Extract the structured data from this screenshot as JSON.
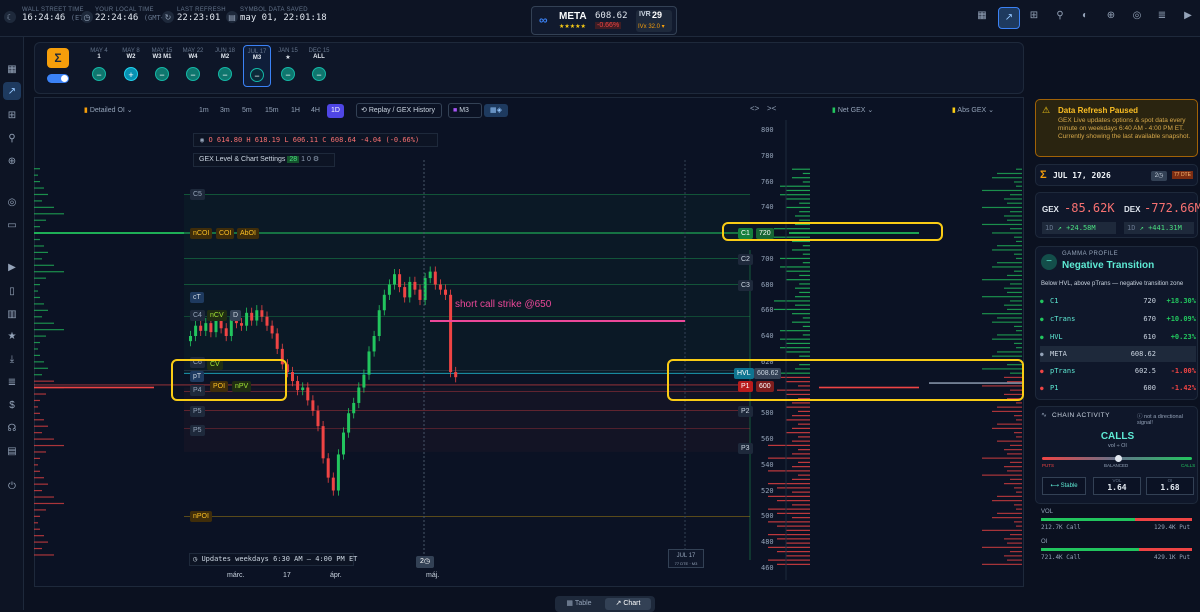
{
  "topbar": {
    "wst_label": "WALL STREET TIME",
    "wst_value": "16:24:46",
    "wst_tz": "(ET)",
    "local_label": "YOUR LOCAL TIME",
    "local_value": "22:24:46",
    "local_tz": "(GMT+2)",
    "refresh_label": "LAST REFRESH",
    "refresh_value": "22:23:01",
    "saved_label": "SYMBOL DATA SAVED",
    "saved_value": "may 01, 22:01:18"
  },
  "ticker": {
    "symbol": "META",
    "stars": "★★★★★",
    "price": "608.62",
    "change": "-0.66%",
    "ivr_label": "IVR",
    "ivr_value": "29",
    "iv_text": "IVx 32.0 ▾"
  },
  "expirations": [
    {
      "date": "MAY 4",
      "label": "1",
      "btn": "−"
    },
    {
      "date": "MAY 8",
      "label": "W2",
      "btn": "+"
    },
    {
      "date": "MAY 15",
      "label": "W3 M1",
      "btn": "−"
    },
    {
      "date": "MAY 22",
      "label": "W4",
      "btn": "−"
    },
    {
      "date": "JUN 18",
      "label": "M2",
      "btn": "−"
    },
    {
      "date": "JUL 17",
      "label": "M3",
      "btn": "−"
    },
    {
      "date": "JAN 15",
      "label": "★",
      "btn": "−"
    },
    {
      "date": "DEC 15",
      "label": "ALL",
      "btn": "−"
    }
  ],
  "toolbar": {
    "detailed_oi": "Detailed OI ⌄",
    "timeframes": [
      "1m",
      "3m",
      "5m",
      "15m",
      "1H",
      "4H",
      "1D"
    ],
    "replay": "Replay / GEX History",
    "m3": "M3",
    "net_gex": "Net GEX ⌄",
    "abs_gex": "Abs GEX ⌄"
  },
  "ohlc": {
    "o": "O 614.80",
    "h": "H 618.19",
    "l": "L 606.11",
    "c": "C 608.64",
    "chg": "-4.04 (-0.66%)"
  },
  "settings": {
    "label": "GEX Level & Chart Settings",
    "badge1": "28",
    "badge2": "1",
    "badge3": "0"
  },
  "price_axis": [
    "800",
    "780",
    "760",
    "740",
    "720",
    "700",
    "680",
    "660",
    "640",
    "620",
    "600",
    "580",
    "560",
    "540",
    "520",
    "500",
    "480",
    "460"
  ],
  "date_axis": [
    "márc.",
    "17",
    "ápr.",
    "máj."
  ],
  "levels": {
    "c1": "C1",
    "c1v": "720",
    "c2": "C2",
    "c3": "C3",
    "hvl": "HVL",
    "hvl_v": "608.62",
    "p1": "P1",
    "p1v": "600",
    "p2": "P2",
    "p3": "P3"
  },
  "left_tags": {
    "c5": "C5",
    "ncoi": "nCOI",
    "coi": "COI",
    "aboi": "AbOI",
    "ct": "cT",
    "c4": "C4",
    "ncv": "nCV",
    "d": "D",
    "cv": "CV",
    "pt": "pT",
    "poi": "POI",
    "npv": "nPV",
    "p5a": "P5",
    "p5b": "P5",
    "npoi": "nPOI",
    "c6": "C6",
    "p4": "P4"
  },
  "annotation": "short call strike @650",
  "footer_note": "Updates weekdays 6:30 AM – 4:00 PM ET",
  "footer_badge": "2",
  "expiry_marker": {
    "date": "JUL 17",
    "sub": "77 DTE · M3"
  },
  "alert": {
    "title": "Data Refresh Paused",
    "body": "GEX Live updates options & spot data every minute on weekdays 6:40 AM - 4:00 PM ET. Currently showing the last available snapshot."
  },
  "summary": {
    "date": "JUL 17, 2026",
    "dte": "77 DTE",
    "gex_label": "GEX",
    "gex_value": "-85.62K",
    "dex_label": "DEX",
    "dex_value": "-772.66M",
    "gex_1d": "1D",
    "gex_chg": "+24.58M",
    "dex_1d": "1D",
    "dex_chg": "+441.31M"
  },
  "gamma": {
    "title": "GAMMA PROFILE",
    "state": "Negative Transition",
    "desc": "Below HVL, above pTrans — negative transition zone",
    "rows": [
      {
        "name": "C1",
        "val": "720",
        "pct": "+18.30%",
        "color": "#22c55e"
      },
      {
        "name": "cTrans",
        "val": "670",
        "pct": "+10.09%",
        "color": "#22c55e"
      },
      {
        "name": "HVL",
        "val": "610",
        "pct": "+0.23%",
        "color": "#22c55e"
      },
      {
        "name": "META",
        "val": "608.62",
        "pct": "",
        "color": "#94a3b8"
      },
      {
        "name": "pTrans",
        "val": "602.5",
        "pct": "-1.00%",
        "color": "#ef4444"
      },
      {
        "name": "P1",
        "val": "600",
        "pct": "-1.42%",
        "color": "#ef4444"
      }
    ]
  },
  "chain": {
    "title": "CHAIN ACTIVITY",
    "note": "not a directional signal!",
    "side": "CALLS",
    "sub": "vol ÷ OI",
    "puts": "PUTS",
    "balanced": "BALANCED",
    "calls": "CALLS",
    "stable": "Stable",
    "vol_label": "VOL",
    "vol_val": "1.64",
    "oi_label": "OI",
    "oi_val": "1.68"
  },
  "vol": {
    "label": "VOL",
    "call": "212.7K Call",
    "put": "129.4K Put"
  },
  "oi": {
    "label": "OI",
    "call": "721.4K Call",
    "put": "429.1K Put"
  },
  "tabs": {
    "table": "Table",
    "chart": "Chart"
  }
}
